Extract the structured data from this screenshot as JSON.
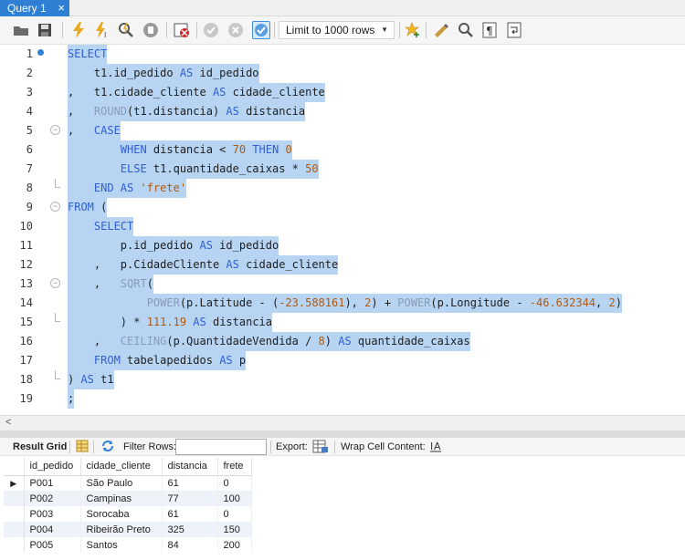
{
  "tab": {
    "title": "Query 1",
    "close": "×"
  },
  "toolbar": {
    "limit_select": "Limit to 1000 rows",
    "limit_arrow": "▼"
  },
  "editor": {
    "lines": [
      {
        "n": "1"
      },
      {
        "n": "2"
      },
      {
        "n": "3"
      },
      {
        "n": "4"
      },
      {
        "n": "5"
      },
      {
        "n": "6"
      },
      {
        "n": "7"
      },
      {
        "n": "8"
      },
      {
        "n": "9"
      },
      {
        "n": "10"
      },
      {
        "n": "11"
      },
      {
        "n": "12"
      },
      {
        "n": "13"
      },
      {
        "n": "14"
      },
      {
        "n": "15"
      },
      {
        "n": "16"
      },
      {
        "n": "17"
      },
      {
        "n": "18"
      },
      {
        "n": "19"
      }
    ],
    "code": {
      "l1": "SELECT",
      "l2a": "    t1.id_pedido ",
      "l2b": "AS",
      "l2c": " id_pedido",
      "l3a": ",   t1.cidade_cliente ",
      "l3b": "AS",
      "l3c": " cidade_cliente",
      "l4a": ",   ",
      "l4b": "ROUND",
      "l4c": "(t1.distancia) ",
      "l4d": "AS",
      "l4e": " distancia",
      "l5a": ",   ",
      "l5b": "CASE",
      "l6a": "        ",
      "l6b": "WHEN",
      "l6c": " distancia < ",
      "l6d": "70",
      "l6e": " ",
      "l6f": "THEN",
      "l6g": " ",
      "l6h": "0",
      "l7a": "        ",
      "l7b": "ELSE",
      "l7c": " t1.quantidade_caixas * ",
      "l7d": "50",
      "l8a": "    ",
      "l8b": "END AS",
      "l8c": " ",
      "l8d": "'frete'",
      "l9a": "FROM",
      "l9b": " (",
      "l10a": "    ",
      "l10b": "SELECT",
      "l11a": "        p.id_pedido ",
      "l11b": "AS",
      "l11c": " id_pedido",
      "l12a": "    ,   p.CidadeCliente ",
      "l12b": "AS",
      "l12c": " cidade_cliente",
      "l13a": "    ,   ",
      "l13b": "SQRT",
      "l13c": "(",
      "l14a": "            ",
      "l14b": "POWER",
      "l14c": "(p.Latitude - (",
      "l14d": "-23.588161",
      "l14e": "), ",
      "l14f": "2",
      "l14g": ") + ",
      "l14h": "POWER",
      "l14i": "(p.Longitude - ",
      "l14j": "-46.632344",
      "l14k": ", ",
      "l14l": "2",
      "l14m": ")",
      "l15a": "        ) * ",
      "l15b": "111.19",
      "l15c": " ",
      "l15d": "AS",
      "l15e": " distancia",
      "l16a": "    ,   ",
      "l16b": "CEILING",
      "l16c": "(p.QuantidadeVendida / ",
      "l16d": "8",
      "l16e": ") ",
      "l16f": "AS",
      "l16g": " quantidade_caixas",
      "l17a": "    ",
      "l17b": "FROM",
      "l17c": " tabelapedidos ",
      "l17d": "AS",
      "l17e": " p",
      "l18a": ") ",
      "l18b": "AS",
      "l18c": " t1",
      "l19": ";"
    }
  },
  "scroll": {
    "left_arrow": "<"
  },
  "result_toolbar": {
    "result_grid": "Result Grid",
    "filter_rows": "Filter Rows:",
    "export": "Export:",
    "wrap": "Wrap Cell Content:"
  },
  "grid": {
    "columns": [
      "id_pedido",
      "cidade_cliente",
      "distancia",
      "frete"
    ],
    "rows": [
      [
        "P001",
        "São Paulo",
        "61",
        "0"
      ],
      [
        "P002",
        "Campinas",
        "77",
        "100"
      ],
      [
        "P003",
        "Sorocaba",
        "61",
        "0"
      ],
      [
        "P004",
        "Ribeirão Preto",
        "325",
        "150"
      ],
      [
        "P005",
        "Santos",
        "84",
        "200"
      ]
    ],
    "cursor": "▶"
  }
}
